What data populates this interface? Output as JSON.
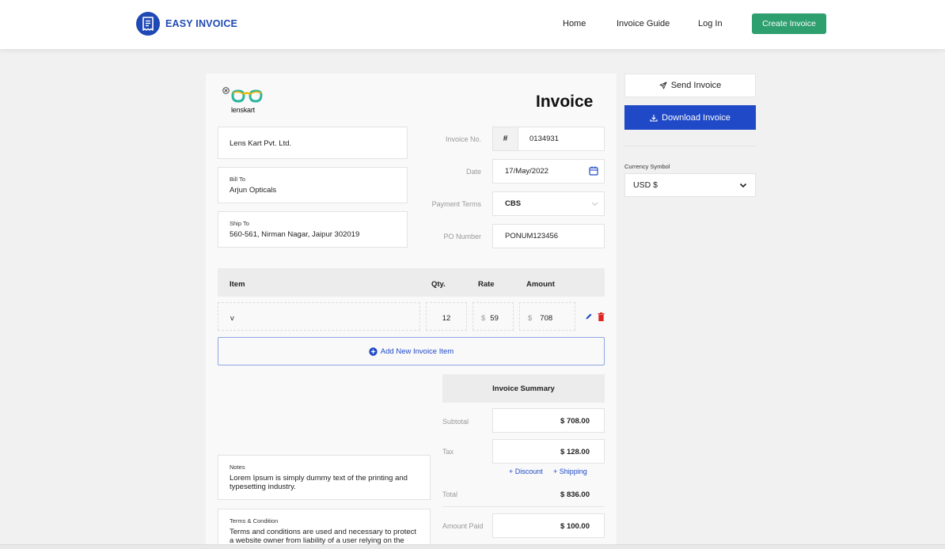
{
  "header": {
    "brand": "EASY INVOICE",
    "nav": [
      "Home",
      "Invoice Guide",
      "Log In"
    ],
    "create_button": "Create Invoice"
  },
  "invoice": {
    "logo_text": "lenskart",
    "title": "Invoice",
    "from": "Lens Kart Pvt. Ltd.",
    "bill_to_label": "Bill To",
    "bill_to": "Arjun Opticals",
    "ship_to_label": "Ship To",
    "ship_to": "560-561, Nirman Nagar, Jaipur 302019",
    "invoice_no_label": "Invoice No.",
    "invoice_no_prefix": "#",
    "invoice_no": "0134931",
    "date_label": "Date",
    "date": "17/May/2022",
    "payment_terms_label": "Payment Terms",
    "payment_terms": "CBS",
    "po_label": "PO Number",
    "po_number": "PONUM123456"
  },
  "items_table": {
    "headers": {
      "item": "Item",
      "qty": "Qty.",
      "rate": "Rate",
      "amount": "Amount"
    },
    "rows": [
      {
        "item": "v",
        "qty": "12",
        "rate_symbol": "$",
        "rate": "59",
        "amount_symbol": "$",
        "amount": "708"
      }
    ],
    "add_item": "Add New Invoice Item"
  },
  "summary": {
    "title": "Invoice Summary",
    "subtotal_label": "Subtotal",
    "subtotal": "$ 708.00",
    "tax_label": "Tax",
    "tax": "$ 128.00",
    "discount_link": "+ Discount",
    "shipping_link": "+ Shipping",
    "total_label": "Total",
    "total": "$ 836.00",
    "paid_label": "Amount Paid",
    "paid": "$ 100.00"
  },
  "notes": {
    "label": "Notes",
    "text": "Lorem Ipsum is simply dummy text of the printing and typesetting industry."
  },
  "terms": {
    "label": "Terms & Condition",
    "text": "Terms and conditions are used and necessary to protect a website owner from liability of a user relying on the"
  },
  "sidebar": {
    "send_button": "Send Invoice",
    "download_button": "Download Invoice",
    "currency_label": "Currency Symbol",
    "currency_value": "USD $"
  },
  "colors": {
    "brand": "#1f49b5",
    "create_button": "#2e9f6e",
    "download_button": "#1f49c7",
    "delete_icon": "#e02424"
  }
}
